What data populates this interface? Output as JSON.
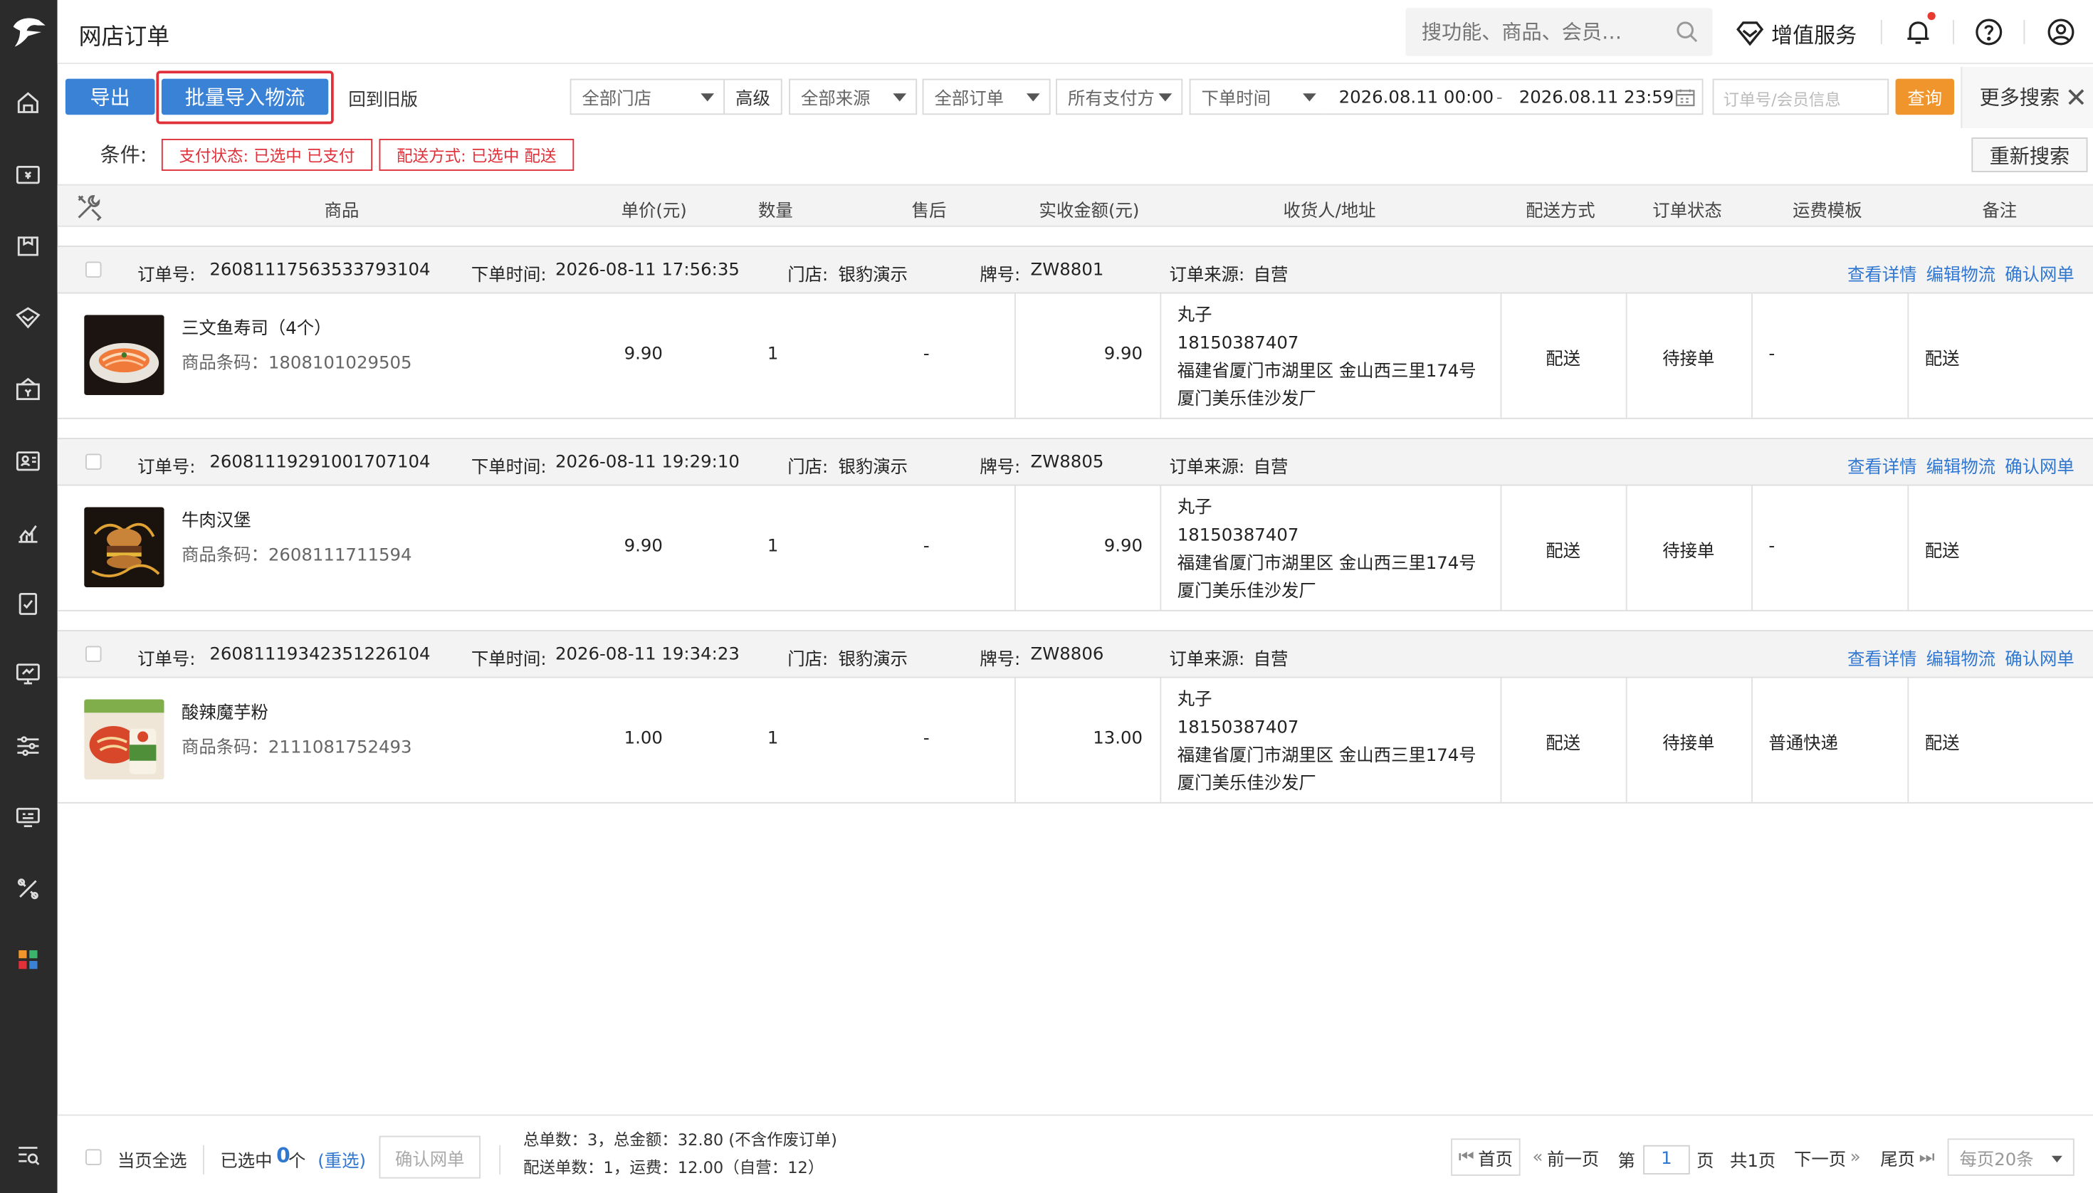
{
  "header": {
    "title": "网店订单",
    "search_placeholder": "搜功能、商品、会员…",
    "value_added_service": "增值服务"
  },
  "toolbar": {
    "export_label": "导出",
    "bulk_import_label": "批量导入物流",
    "old_version_label": "回到旧版",
    "store_select": "全部门店",
    "advanced_label": "高级",
    "source_select": "全部来源",
    "order_select": "全部订单",
    "payment_select": "所有支付方",
    "time_select": "下单时间",
    "date_start": "2026.08.11 00:00",
    "date_sep": "-",
    "date_end": "2026.08.11 23:59",
    "order_input_placeholder": "订单号/会员信息",
    "query_label": "查询",
    "more_search_label": "更多搜索",
    "close_label": "✕"
  },
  "conditions": {
    "label": "条件:",
    "tags": [
      "支付状态: 已选中 已支付",
      "配送方式: 已选中 配送"
    ],
    "research_label": "重新搜索"
  },
  "table": {
    "columns": [
      "商品",
      "单价(元)",
      "数量",
      "售后",
      "实收金额(元)",
      "收货人/地址",
      "配送方式",
      "订单状态",
      "运费模板",
      "备注"
    ]
  },
  "orders": [
    {
      "order_no_label": "订单号:",
      "order_no": "26081117563533793104",
      "time_label": "下单时间:",
      "time": "2026-08-11 17:56:35",
      "store_label": "门店:",
      "store": "银豹演示",
      "plate_label": "牌号:",
      "plate": "ZW8801",
      "source_label": "订单来源:",
      "source": "自营",
      "links": [
        "查看详情",
        "编辑物流",
        "确认网单"
      ],
      "product_name": "三文鱼寿司（4个）",
      "product_code": "商品条码：1808101029505",
      "price": "9.90",
      "qty": "1",
      "after_sale": "-",
      "amount": "9.90",
      "receiver": "丸子",
      "phone": "18150387407",
      "address1": "福建省厦门市湖里区 金山西三里174号",
      "address2": "厦门美乐佳沙发厂",
      "delivery": "配送",
      "status": "待接单",
      "freight_template": "-",
      "remark": "配送",
      "thumb": "sushi-image"
    },
    {
      "order_no_label": "订单号:",
      "order_no": "26081119291001707104",
      "time_label": "下单时间:",
      "time": "2026-08-11 19:29:10",
      "store_label": "门店:",
      "store": "银豹演示",
      "plate_label": "牌号:",
      "plate": "ZW8805",
      "source_label": "订单来源:",
      "source": "自营",
      "links": [
        "查看详情",
        "编辑物流",
        "确认网单"
      ],
      "product_name": "牛肉汉堡",
      "product_code": "商品条码：2608111711594",
      "price": "9.90",
      "qty": "1",
      "after_sale": "-",
      "amount": "9.90",
      "receiver": "丸子",
      "phone": "18150387407",
      "address1": "福建省厦门市湖里区 金山西三里174号",
      "address2": "厦门美乐佳沙发厂",
      "delivery": "配送",
      "status": "待接单",
      "freight_template": "-",
      "remark": "配送",
      "thumb": "burger-image"
    },
    {
      "order_no_label": "订单号:",
      "order_no": "26081119342351226104",
      "time_label": "下单时间:",
      "time": "2026-08-11 19:34:23",
      "store_label": "门店:",
      "store": "银豹演示",
      "plate_label": "牌号:",
      "plate": "ZW8806",
      "source_label": "订单来源:",
      "source": "自营",
      "links": [
        "查看详情",
        "编辑物流",
        "确认网单"
      ],
      "product_name": "酸辣魔芋粉",
      "product_code": "商品条码：2111081752493",
      "price": "1.00",
      "qty": "1",
      "after_sale": "-",
      "amount": "13.00",
      "receiver": "丸子",
      "phone": "18150387407",
      "address1": "福建省厦门市湖里区 金山西三里174号",
      "address2": "厦门美乐佳沙发厂",
      "delivery": "配送",
      "status": "待接单",
      "freight_template": "普通快递",
      "remark": "配送",
      "thumb": "noodle-cup-image"
    }
  ],
  "footer": {
    "select_all_label": "当页全选",
    "selected_prefix": "已选中",
    "selected_count": "0",
    "selected_suffix": "个",
    "reselect_label": "(重选)",
    "confirm_label": "确认网单",
    "summary_line1": "总单数：3，总金额：32.80 (不含作废订单)",
    "summary_line2": "配送单数：1，运费：12.00（自营：12）",
    "first_label": "首页",
    "prev_label": "前一页",
    "page_prefix": "第",
    "page_value": "1",
    "page_suffix": "页",
    "total_pages": "共1页",
    "next_label": "下一页",
    "last_label": "尾页",
    "per_page": "每页20条"
  },
  "colors": {
    "sidebar_bg": "#2b2b2b",
    "primary_blue": "#3a82d6",
    "link_blue": "#2f77d1",
    "query_orange": "#f0952b",
    "highlight_red": "#e0313a"
  }
}
